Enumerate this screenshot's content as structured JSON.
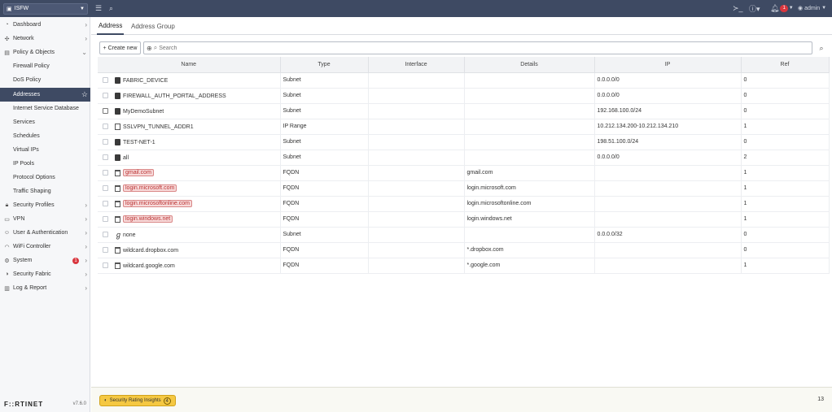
{
  "topbar": {
    "device": "ISFW",
    "notif_count": "1",
    "user": "admin"
  },
  "sidebar": {
    "items": [
      {
        "label": "Dashboard",
        "icon": "dashboard-icon",
        "chev": "›"
      },
      {
        "label": "Network",
        "icon": "network-icon",
        "chev": "›"
      },
      {
        "label": "Policy & Objects",
        "icon": "policy-icon",
        "chev": "⌄"
      },
      {
        "label": "Firewall Policy"
      },
      {
        "label": "DoS Policy"
      },
      {
        "label": "Addresses"
      },
      {
        "label": "Internet Service Database"
      },
      {
        "label": "Services"
      },
      {
        "label": "Schedules"
      },
      {
        "label": "Virtual IPs"
      },
      {
        "label": "IP Pools"
      },
      {
        "label": "Protocol Options"
      },
      {
        "label": "Traffic Shaping"
      },
      {
        "label": "Security Profiles",
        "icon": "lock-icon",
        "chev": "›"
      },
      {
        "label": "VPN",
        "icon": "vpn-icon",
        "chev": "›"
      },
      {
        "label": "User & Authentication",
        "icon": "user-icon",
        "chev": "›"
      },
      {
        "label": "WiFi Controller",
        "icon": "wifi-icon",
        "chev": "›"
      },
      {
        "label": "System",
        "icon": "gear-icon",
        "chev": "›",
        "badge": "1"
      },
      {
        "label": "Security Fabric",
        "icon": "fabric-icon",
        "chev": "›"
      },
      {
        "label": "Log & Report",
        "icon": "chart-icon",
        "chev": "›"
      }
    ],
    "logo": "F::RTINET",
    "version": "v7.6.0"
  },
  "tabs": [
    "Address",
    "Address Group"
  ],
  "toolbar": {
    "create_label": "Create new",
    "search_placeholder": "Search"
  },
  "table": {
    "columns": [
      "Name",
      "Type",
      "Interface",
      "Details",
      "IP",
      "Ref"
    ],
    "rows": [
      {
        "name": "FABRIC_DEVICE",
        "icon": "subnet",
        "type": "Subnet",
        "interface": "",
        "details": "",
        "ip": "0.0.0.0/0",
        "ref": "0"
      },
      {
        "name": "FIREWALL_AUTH_PORTAL_ADDRESS",
        "icon": "subnet",
        "type": "Subnet",
        "interface": "",
        "details": "",
        "ip": "0.0.0.0/0",
        "ref": "0"
      },
      {
        "name": "MyDemoSubnet",
        "icon": "subnet",
        "type": "Subnet",
        "interface": "",
        "details": "",
        "ip": "192.168.100.0/24",
        "ref": "0"
      },
      {
        "name": "SSLVPN_TUNNEL_ADDR1",
        "icon": "range",
        "type": "IP Range",
        "interface": "",
        "details": "",
        "ip": "10.212.134.200-10.212.134.210",
        "ref": "1"
      },
      {
        "name": "TEST-NET-1",
        "icon": "subnet",
        "type": "Subnet",
        "interface": "",
        "details": "",
        "ip": "198.51.100.0/24",
        "ref": "0"
      },
      {
        "name": "all",
        "icon": "subnet",
        "type": "Subnet",
        "interface": "",
        "details": "",
        "ip": "0.0.0.0/0",
        "ref": "2"
      },
      {
        "name": "gmail.com",
        "icon": "fqdn",
        "type": "FQDN",
        "interface": "",
        "details": "gmail.com",
        "ip": "",
        "ref": "1",
        "highlight": true
      },
      {
        "name": "login.microsoft.com",
        "icon": "fqdn",
        "type": "FQDN",
        "interface": "",
        "details": "login.microsoft.com",
        "ip": "",
        "ref": "1",
        "highlight": true
      },
      {
        "name": "login.microsoftonline.com",
        "icon": "fqdn",
        "type": "FQDN",
        "interface": "",
        "details": "login.microsoftonline.com",
        "ip": "",
        "ref": "1",
        "highlight": true
      },
      {
        "name": "login.windows.net",
        "icon": "fqdn",
        "type": "FQDN",
        "interface": "",
        "details": "login.windows.net",
        "ip": "",
        "ref": "1",
        "highlight": true
      },
      {
        "name": "none",
        "icon": "none",
        "type": "Subnet",
        "interface": "",
        "details": "",
        "ip": "0.0.0.0/32",
        "ref": "0"
      },
      {
        "name": "wildcard.dropbox.com",
        "icon": "fqdn",
        "type": "FQDN",
        "interface": "",
        "details": "*.dropbox.com",
        "ip": "",
        "ref": "0"
      },
      {
        "name": "wildcard.google.com",
        "icon": "fqdn",
        "type": "FQDN",
        "interface": "",
        "details": "*.google.com",
        "ip": "",
        "ref": "1"
      }
    ]
  },
  "bottom": {
    "insights_label": "Security Rating Insights",
    "insights_count": "4",
    "total": "13"
  }
}
